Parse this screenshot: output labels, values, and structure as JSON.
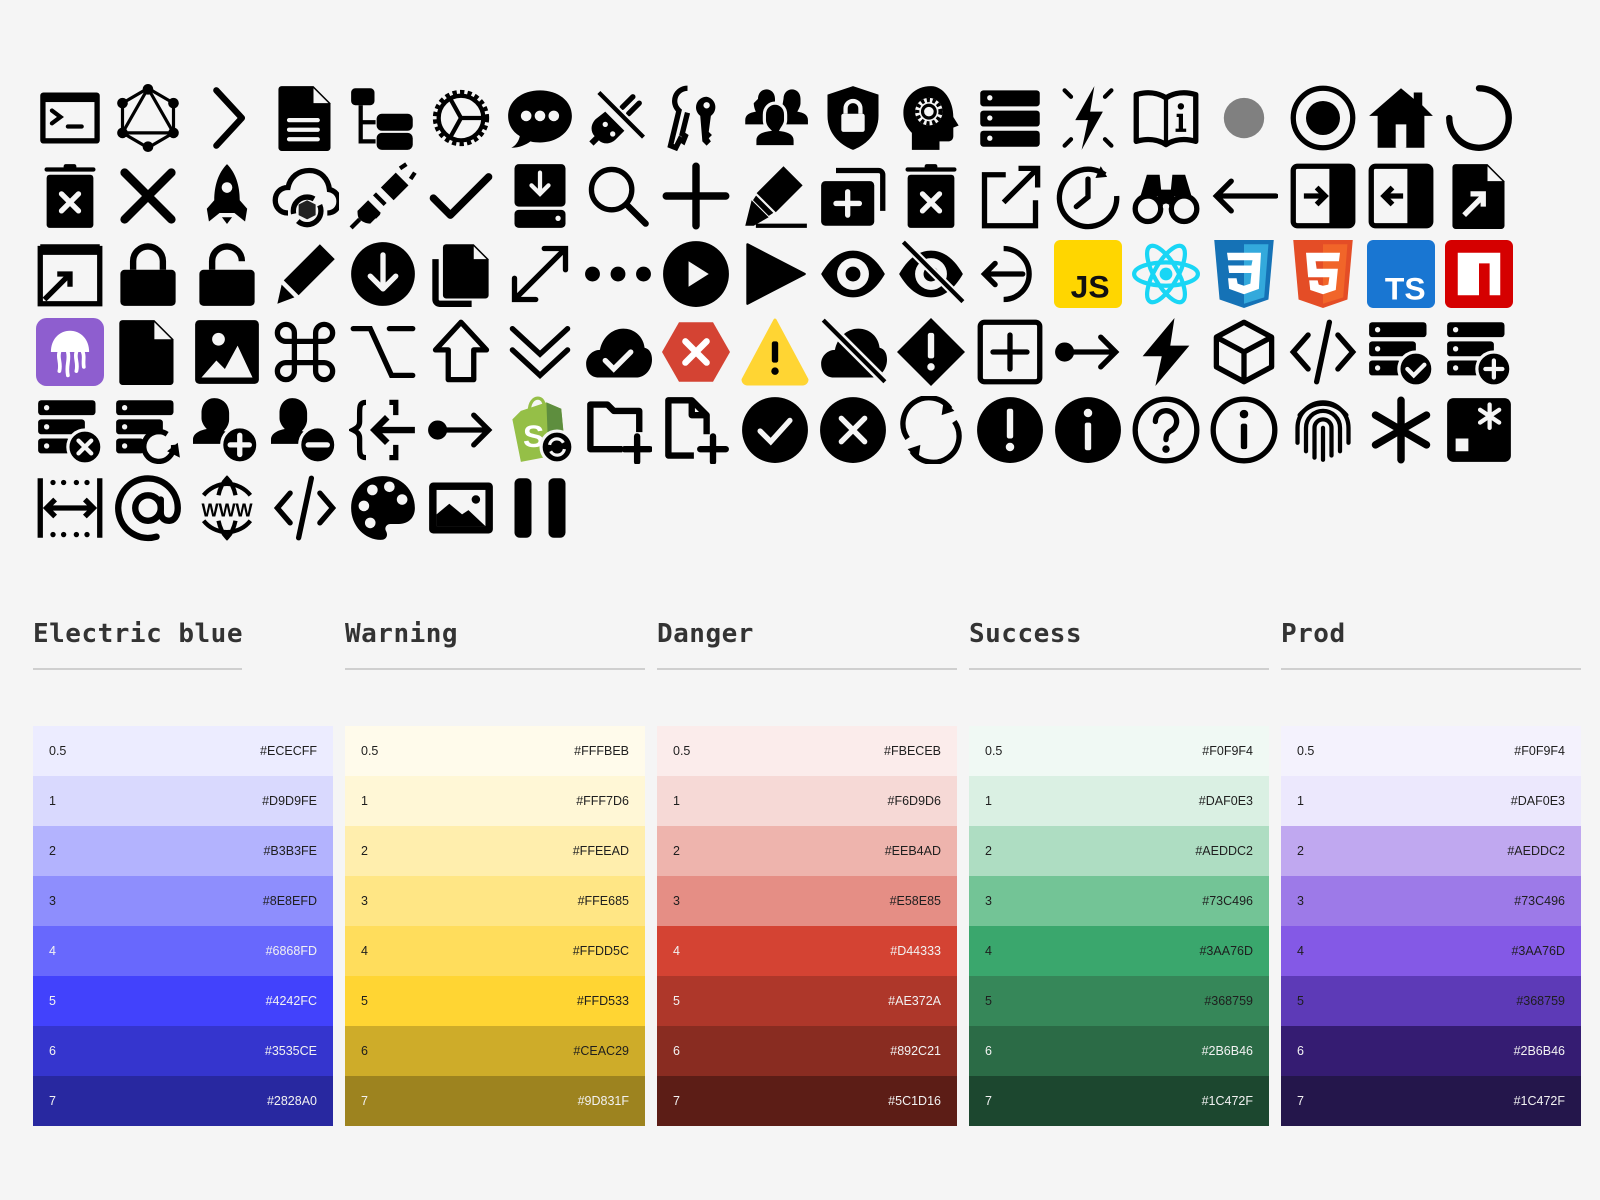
{
  "icons": [
    "terminal-icon",
    "graphql-icon",
    "chevron-right-icon",
    "document-icon",
    "sitemap-icon",
    "gear-icon",
    "chat-bubble-icon",
    "plug-off-icon",
    "keys-icon",
    "users-icon",
    "shield-lock-icon",
    "head-gear-icon",
    "server-icon",
    "flash-icon",
    "book-info-icon",
    "gray-dot-icon",
    "radio-selected-icon",
    "home-icon",
    "spinner-icon",
    "trash-x-icon",
    "close-icon",
    "rocket-icon",
    "cloud-sync-icon",
    "plug-icon",
    "check-icon",
    "download-drive-icon",
    "search-icon",
    "plus-icon",
    "highlighter-icon",
    "add-folder-stack-icon",
    "trash-x-alt-icon",
    "external-link-icon",
    "clock-rotate-icon",
    "binoculars-icon",
    "arrow-left-icon",
    "panel-enter-icon",
    "panel-exit-icon",
    "file-export-icon",
    "open-window-icon",
    "lock-icon",
    "unlock-icon",
    "pencil-icon",
    "circle-down-icon",
    "copy-icon",
    "expand-icon",
    "ellipsis-icon",
    "play-circle-icon",
    "play-icon",
    "eye-icon",
    "eye-off-icon",
    "logout-icon",
    "javascript-icon",
    "react-icon",
    "css3-icon",
    "html5-icon",
    "typescript-icon",
    "npm-icon",
    "jellyfish-icon",
    "file-icon",
    "image-icon",
    "command-key-icon",
    "option-key-icon",
    "shift-key-icon",
    "double-chevron-down-icon",
    "cloud-check-icon",
    "error-hexagon-icon",
    "warning-icon",
    "cloud-off-icon",
    "diamond-alert-icon",
    "square-plus-icon",
    "connection-arrow-icon",
    "bolt-icon",
    "cube-icon",
    "code-icon",
    "server-check-icon",
    "server-add-icon",
    "server-remove-icon",
    "server-refresh-icon",
    "user-add-icon",
    "user-remove-icon",
    "json-import-icon",
    "connection-arrow-alt-icon",
    "shopify-sync-icon",
    "folder-add-icon",
    "file-add-icon",
    "circle-check-icon",
    "circle-x-icon",
    "refresh-icon",
    "circle-exclamation-icon",
    "circle-info-icon",
    "circle-question-icon",
    "circle-info-outline-icon",
    "fingerprint-icon",
    "asterisk-icon",
    "secret-box-icon",
    "width-icon",
    "at-sign-icon",
    "www-icon",
    "code-slash-icon",
    "palette-icon",
    "picture-icon",
    "pause-icon"
  ],
  "palettes": [
    {
      "name": "Electric blue",
      "rows": [
        {
          "step": "0.5",
          "hex": "#ECECFF",
          "text": "dark"
        },
        {
          "step": "1",
          "hex": "#D9D9FE",
          "text": "dark"
        },
        {
          "step": "2",
          "hex": "#B3B3FE",
          "text": "dark"
        },
        {
          "step": "3",
          "hex": "#8E8EFD",
          "text": "dark"
        },
        {
          "step": "4",
          "hex": "#6868FD",
          "text": "light"
        },
        {
          "step": "5",
          "hex": "#4242FC",
          "text": "light"
        },
        {
          "step": "6",
          "hex": "#3535CE",
          "text": "light"
        },
        {
          "step": "7",
          "hex": "#2828A0",
          "text": "light"
        }
      ]
    },
    {
      "name": "Warning",
      "rows": [
        {
          "step": "0.5",
          "hex": "#FFFBEB",
          "text": "dark"
        },
        {
          "step": "1",
          "hex": "#FFF7D6",
          "text": "dark"
        },
        {
          "step": "2",
          "hex": "#FFEEAD",
          "text": "dark"
        },
        {
          "step": "3",
          "hex": "#FFE685",
          "text": "dark"
        },
        {
          "step": "4",
          "hex": "#FFDD5C",
          "text": "dark"
        },
        {
          "step": "5",
          "hex": "#FFD533",
          "text": "dark"
        },
        {
          "step": "6",
          "hex": "#CEAC29",
          "text": "dark"
        },
        {
          "step": "7",
          "hex": "#9D831F",
          "text": "light"
        }
      ]
    },
    {
      "name": "Danger",
      "rows": [
        {
          "step": "0.5",
          "hex": "#FBECEB",
          "text": "dark"
        },
        {
          "step": "1",
          "hex": "#F6D9D6",
          "text": "dark"
        },
        {
          "step": "2",
          "hex": "#EEB4AD",
          "text": "dark"
        },
        {
          "step": "3",
          "hex": "#E58E85",
          "text": "dark"
        },
        {
          "step": "4",
          "hex": "#D44333",
          "text": "light"
        },
        {
          "step": "5",
          "hex": "#AE372A",
          "text": "light"
        },
        {
          "step": "6",
          "hex": "#892C21",
          "text": "light"
        },
        {
          "step": "7",
          "hex": "#5C1D16",
          "text": "light"
        }
      ]
    },
    {
      "name": "Success",
      "rows": [
        {
          "step": "0.5",
          "hex": "#F0F9F4",
          "text": "dark"
        },
        {
          "step": "1",
          "hex": "#DAF0E3",
          "text": "dark"
        },
        {
          "step": "2",
          "hex": "#AEDDC2",
          "text": "dark"
        },
        {
          "step": "3",
          "hex": "#73C496",
          "text": "dark"
        },
        {
          "step": "4",
          "hex": "#3AA76D",
          "text": "dark"
        },
        {
          "step": "5",
          "hex": "#368759",
          "text": "dark"
        },
        {
          "step": "6",
          "hex": "#2B6B46",
          "text": "light"
        },
        {
          "step": "7",
          "hex": "#1C472F",
          "text": "light"
        }
      ]
    },
    {
      "name": "Prod",
      "rows": [
        {
          "step": "0.5",
          "hex": "#F0F9F4",
          "bg": "#F4F2FD",
          "text": "dark"
        },
        {
          "step": "1",
          "hex": "#DAF0E3",
          "bg": "#ECE8FD",
          "text": "dark"
        },
        {
          "step": "2",
          "hex": "#AEDDC2",
          "bg": "#C0A8F0",
          "text": "dark"
        },
        {
          "step": "3",
          "hex": "#73C496",
          "bg": "#9D7AE8",
          "text": "dark"
        },
        {
          "step": "4",
          "hex": "#3AA76D",
          "bg": "#8459E6",
          "text": "dark"
        },
        {
          "step": "5",
          "hex": "#368759",
          "bg": "#5D3AB7",
          "text": "dark"
        },
        {
          "step": "6",
          "hex": "#2B6B46",
          "bg": "#351C72",
          "text": "light"
        },
        {
          "step": "7",
          "hex": "#1C472F",
          "bg": "#24164B",
          "text": "light"
        }
      ]
    }
  ]
}
